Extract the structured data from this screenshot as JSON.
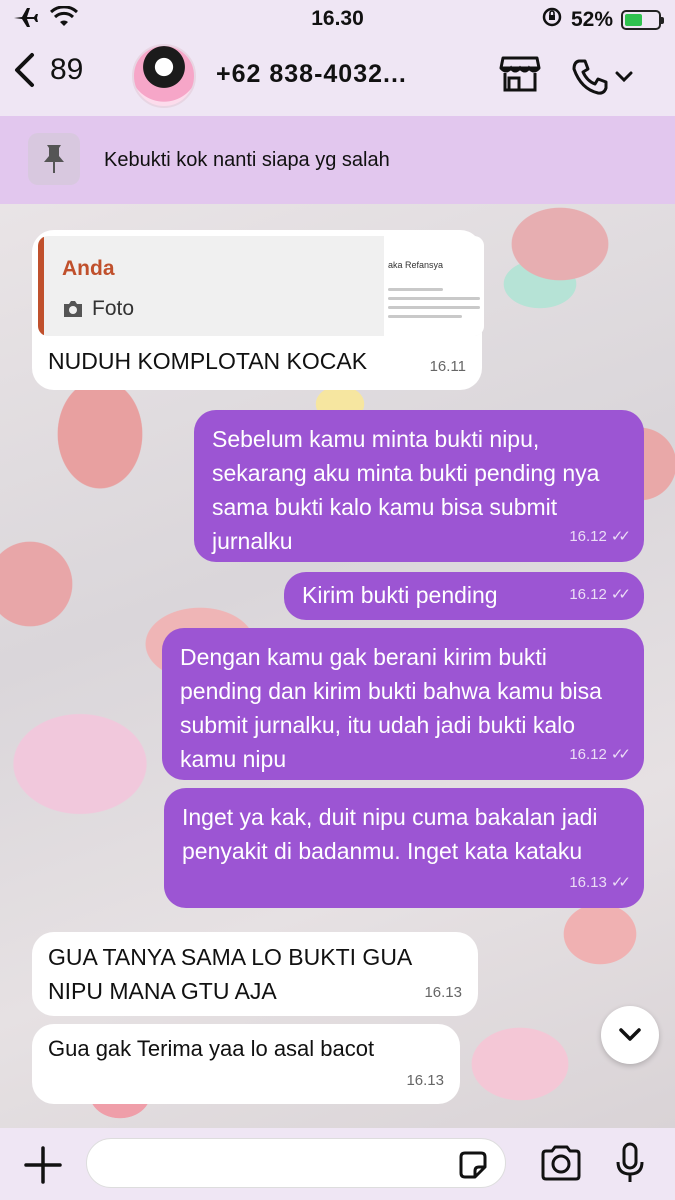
{
  "status": {
    "time": "16.30",
    "battery_text": "52%",
    "battery_level": 0.52
  },
  "header": {
    "back_count": "89",
    "contact": "+62 838-4032..."
  },
  "pinned": {
    "text": "Kebukti kok nanti siapa yg salah"
  },
  "messages": [
    {
      "dir": "in",
      "quote_from": "Anda",
      "quote_type": "Foto",
      "quote_thumb_title": "aka Refansya",
      "text": "NUDUH KOMPLOTAN KOCAK",
      "time": "16.11"
    },
    {
      "dir": "out",
      "text": "Sebelum kamu minta bukti nipu, sekarang aku minta bukti pending nya sama bukti kalo kamu bisa submit jurnalku",
      "time": "16.12"
    },
    {
      "dir": "out",
      "text": "Kirim bukti pending",
      "time": "16.12"
    },
    {
      "dir": "out",
      "text": "Dengan kamu gak berani kirim bukti pending dan kirim bukti bahwa kamu bisa submit jurnalku, itu udah jadi bukti kalo kamu nipu",
      "time": "16.12"
    },
    {
      "dir": "out",
      "text": "Inget ya kak, duit nipu cuma bakalan jadi penyakit di badanmu. Inget kata kataku",
      "time": "16.13"
    },
    {
      "dir": "in",
      "text": "GUA TANYA SAMA LO BUKTI GUA NIPU MANA GTU AJA",
      "time": "16.13"
    },
    {
      "dir": "in",
      "text": "Gua gak Terima yaa lo asal bacot",
      "time": "16.13"
    }
  ],
  "icons": [
    "airplane-icon",
    "wifi-icon",
    "rotation-lock-icon",
    "battery-icon",
    "back-chevron-icon",
    "store-icon",
    "phone-icon",
    "pin-icon",
    "camera-icon",
    "chevron-down-icon",
    "plus-icon",
    "sticker-icon",
    "mic-icon"
  ]
}
